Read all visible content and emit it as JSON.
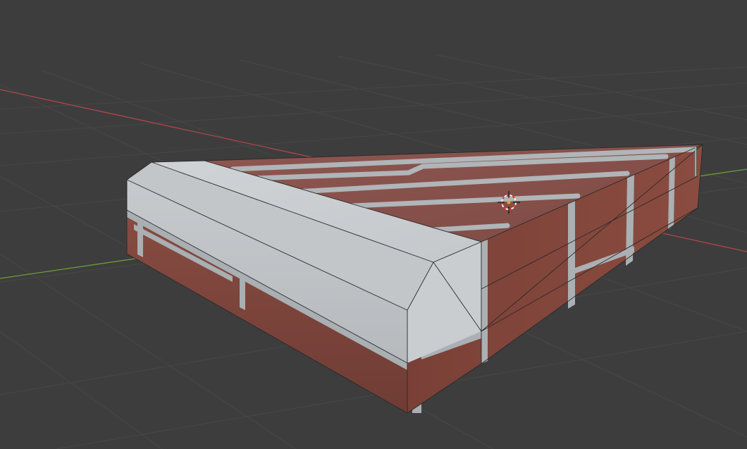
{
  "viewport": {
    "background_color": "#3d3d3d",
    "grid_color": "#4a4a4a",
    "x_axis_color": "#b0454a",
    "y_axis_color": "#6d9a3a"
  },
  "object": {
    "material_brick_color": "#8f4f45",
    "material_mortar_color": "#a9b0b4",
    "capstone_color": "#c9cdd0",
    "edge_color": "#2a2a2a",
    "selected_edge_color": "#2ad6e0"
  },
  "cursor_3d": {
    "icon": "3d-cursor-icon",
    "ring_color_a": "#e03a2f",
    "ring_color_b": "#f2f2f2",
    "origin_color": "#f0a030"
  }
}
